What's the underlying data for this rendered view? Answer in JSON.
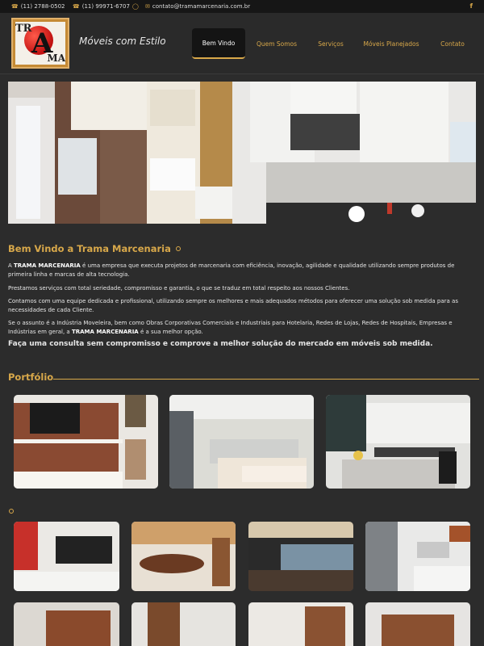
{
  "topbar": {
    "phone1": "(11) 2788-0502",
    "phone2": "(11) 99971-6707",
    "email": "contato@tramamarcenaria.com.br",
    "facebook_icon": "facebook-icon"
  },
  "header": {
    "logo_text_top": "TR",
    "logo_text_letter": "A",
    "logo_text_bottom": "MA",
    "tagline": "Móveis com Estilo"
  },
  "nav": [
    {
      "label": "Bem Vindo",
      "active": true
    },
    {
      "label": "Quem Somos",
      "active": false
    },
    {
      "label": "Serviços",
      "active": false
    },
    {
      "label": "Móveis Planejados",
      "active": false
    },
    {
      "label": "Contato",
      "active": false
    }
  ],
  "welcome": {
    "title": "Bem Vindo a Trama Marcenaria",
    "p1_strong": "TRAMA MARCENARIA",
    "p1_rest": " é uma empresa que executa projetos de marcenaria com eficiência, inovação, agilidade e qualidade utilizando sempre produtos de primeira linha e marcas de alta tecnologia.",
    "p2": "Prestamos serviços com total seriedade, compromisso e garantia, o que se traduz em total respeito aos nossos Clientes.",
    "p3": "Contamos com uma equipe dedicada e profissional, utilizando sempre os melhores e mais adequados métodos para oferecer uma solução sob medida para as necessidades de cada Cliente.",
    "p4_start": "Se o assunto é a Indústria Moveleira, bem como Obras Corporativas Comerciais e Industriais para Hotelaria, Redes de Lojas, Redes de Hospitais, Empresas e Indústrias em geral, a ",
    "p4_strong": "TRAMA MARCENARIA",
    "p4_end": " é a sua melhor opção.",
    "cta": "Faça uma consulta sem compromisso e comprove a melhor solução do mercado em móveis sob medida."
  },
  "portfolio": {
    "title": "Portfólio"
  },
  "colors": {
    "accent": "#d8a84a",
    "background": "#2c2c2c",
    "topbar": "#161616"
  }
}
